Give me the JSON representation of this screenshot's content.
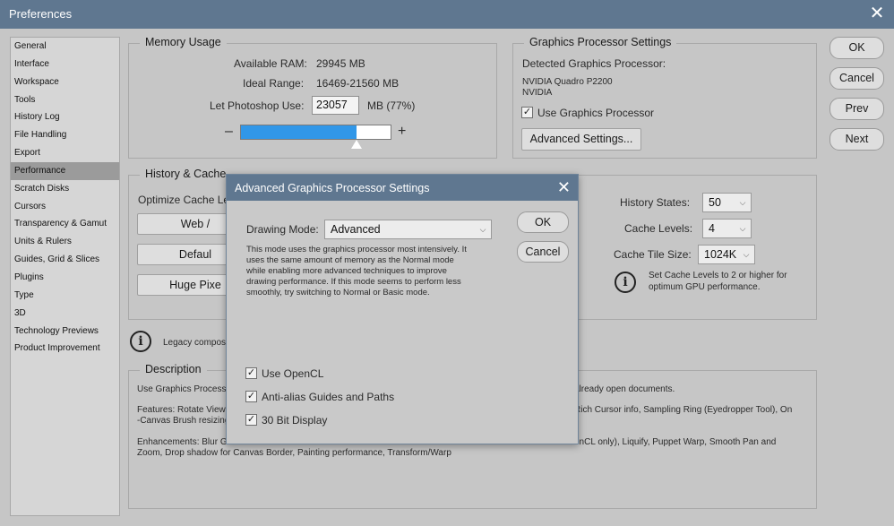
{
  "window": {
    "title": "Preferences"
  },
  "sidebar": {
    "items": [
      "General",
      "Interface",
      "Workspace",
      "Tools",
      "History Log",
      "File Handling",
      "Export",
      "Performance",
      "Scratch Disks",
      "Cursors",
      "Transparency & Gamut",
      "Units & Rulers",
      "Guides, Grid & Slices",
      "Plugins",
      "Type",
      "3D",
      "Technology Previews",
      "Product Improvement"
    ],
    "active": "Performance"
  },
  "memory": {
    "legend": "Memory Usage",
    "available_label": "Available RAM:",
    "available_value": "29945 MB",
    "ideal_label": "Ideal Range:",
    "ideal_value": "16469-21560 MB",
    "use_label": "Let Photoshop Use:",
    "use_value": "23057",
    "use_suffix": "MB (77%)",
    "minus": "–",
    "plus": "+",
    "slider_fraction": 0.77,
    "slider_color": "#3197e8"
  },
  "gpu": {
    "legend": "Graphics Processor Settings",
    "detected_label": "Detected Graphics Processor:",
    "processor_name": "NVIDIA Quadro P2200",
    "vendor": "NVIDIA",
    "use_gpu_label": "Use Graphics Processor",
    "use_gpu_checked": true,
    "advanced_button": "Advanced Settings..."
  },
  "buttons": {
    "ok": "OK",
    "cancel": "Cancel",
    "prev": "Prev",
    "next": "Next"
  },
  "history_cache": {
    "legend": "History & Cache",
    "optimize_label": "Optimize Cache Le",
    "btn1": "Web /",
    "btn2": "Defaul",
    "btn3": "Huge Pixe",
    "history_states_label": "History States:",
    "history_states_value": "50",
    "cache_levels_label": "Cache Levels:",
    "cache_levels_value": "4",
    "cache_tile_label": "Cache Tile Size:",
    "cache_tile_value": "1024K",
    "info_text_1": "Set Cache Levels to 2 or higher for",
    "info_text_2": "optimum GPU performance."
  },
  "legacy": {
    "text": "Legacy composi"
  },
  "description": {
    "legend": "Description",
    "line1_left": "Use Graphics Processo",
    "line1_right": "already open documents.",
    "line2_left": "Features: Rotate View",
    "line2_right": "Rich Cursor info, Sampling Ring (Eyedropper Tool), On",
    "line3_left": "-Canvas Brush resizing",
    "line4_left": "Enhancements: Blur G",
    "line4_right": "enCL only), Liquify, Puppet Warp, Smooth Pan and",
    "line5": "Zoom, Drop shadow for Canvas Border, Painting performance, Transform/Warp"
  },
  "dialog": {
    "title": "Advanced Graphics Processor Settings",
    "drawing_mode_label": "Drawing Mode:",
    "drawing_mode_value": "Advanced",
    "mode_desc": [
      "This mode uses the graphics processor most intensively.  It",
      "uses the same amount of memory as the Normal mode",
      "while enabling more advanced techniques to improve",
      "drawing performance.  If this mode seems to perform less",
      "smoothly, try switching to Normal or Basic mode."
    ],
    "ok": "OK",
    "cancel": "Cancel",
    "opencl_label": "Use OpenCL",
    "opencl_checked": true,
    "antialias_label": "Anti-alias Guides and Paths",
    "antialias_checked": true,
    "bit30_label": "30 Bit Display",
    "bit30_checked": true
  }
}
